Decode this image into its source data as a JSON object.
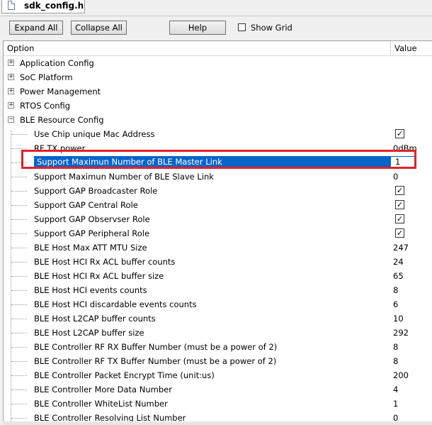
{
  "tab": {
    "title": "sdk_config.h",
    "icon": "file-icon"
  },
  "toolbar": {
    "expand_all": "Expand All",
    "collapse_all": "Collapse All",
    "help": "Help",
    "show_grid": "Show Grid",
    "show_grid_checked": false
  },
  "grid": {
    "col_option": "Option",
    "col_value": "Value",
    "groups": [
      {
        "label": "Application Config",
        "expanded": false
      },
      {
        "label": "SoC Platform",
        "expanded": false
      },
      {
        "label": "Power Management",
        "expanded": false
      },
      {
        "label": "RTOS Config",
        "expanded": false
      },
      {
        "label": "BLE Resource Config",
        "expanded": true
      }
    ],
    "items": [
      {
        "label": "Use Chip unique Mac Address",
        "type": "check",
        "checked": true
      },
      {
        "label": "RF TX power",
        "value": "0dBm"
      },
      {
        "label": "Support Maximun Number of BLE Master Link",
        "value": "1",
        "selected": true
      },
      {
        "label": "Support Maximun Number of BLE Slave Link",
        "value": "0"
      },
      {
        "label": "Support GAP Broadcaster Role",
        "type": "check",
        "checked": true
      },
      {
        "label": "Support GAP Central Role",
        "type": "check",
        "checked": true
      },
      {
        "label": "Support GAP Observser Role",
        "type": "check",
        "checked": true
      },
      {
        "label": "Support GAP Peripheral Role",
        "type": "check",
        "checked": true
      },
      {
        "label": "BLE Host Max ATT MTU Size",
        "value": "247"
      },
      {
        "label": "BLE Host HCI Rx ACL buffer counts",
        "value": "24"
      },
      {
        "label": "BLE Host HCI Rx ACL buffer size",
        "value": "65"
      },
      {
        "label": "BLE Host HCI events counts",
        "value": "8"
      },
      {
        "label": "BLE Host HCI discardable events counts",
        "value": "6"
      },
      {
        "label": "BLE Host L2CAP buffer counts",
        "value": "10"
      },
      {
        "label": "BLE Host L2CAP buffer size",
        "value": "292"
      },
      {
        "label": "BLE Controller RF RX Buffer Number (must be a power of 2)",
        "value": "8"
      },
      {
        "label": "BLE Controller RF TX Buffer Number (must be a power of 2)",
        "value": "8"
      },
      {
        "label": "BLE Controller Packet Encrypt Time (unit:us)",
        "value": "200"
      },
      {
        "label": "BLE Controller More Data Number",
        "value": "4"
      },
      {
        "label": "BLE Controller WhiteList Number",
        "value": "1"
      },
      {
        "label": "BLE Controller Resolving List Number",
        "value": "0"
      }
    ]
  },
  "colors": {
    "selection": "#0a64c8",
    "highlight_border": "#e0232b"
  }
}
